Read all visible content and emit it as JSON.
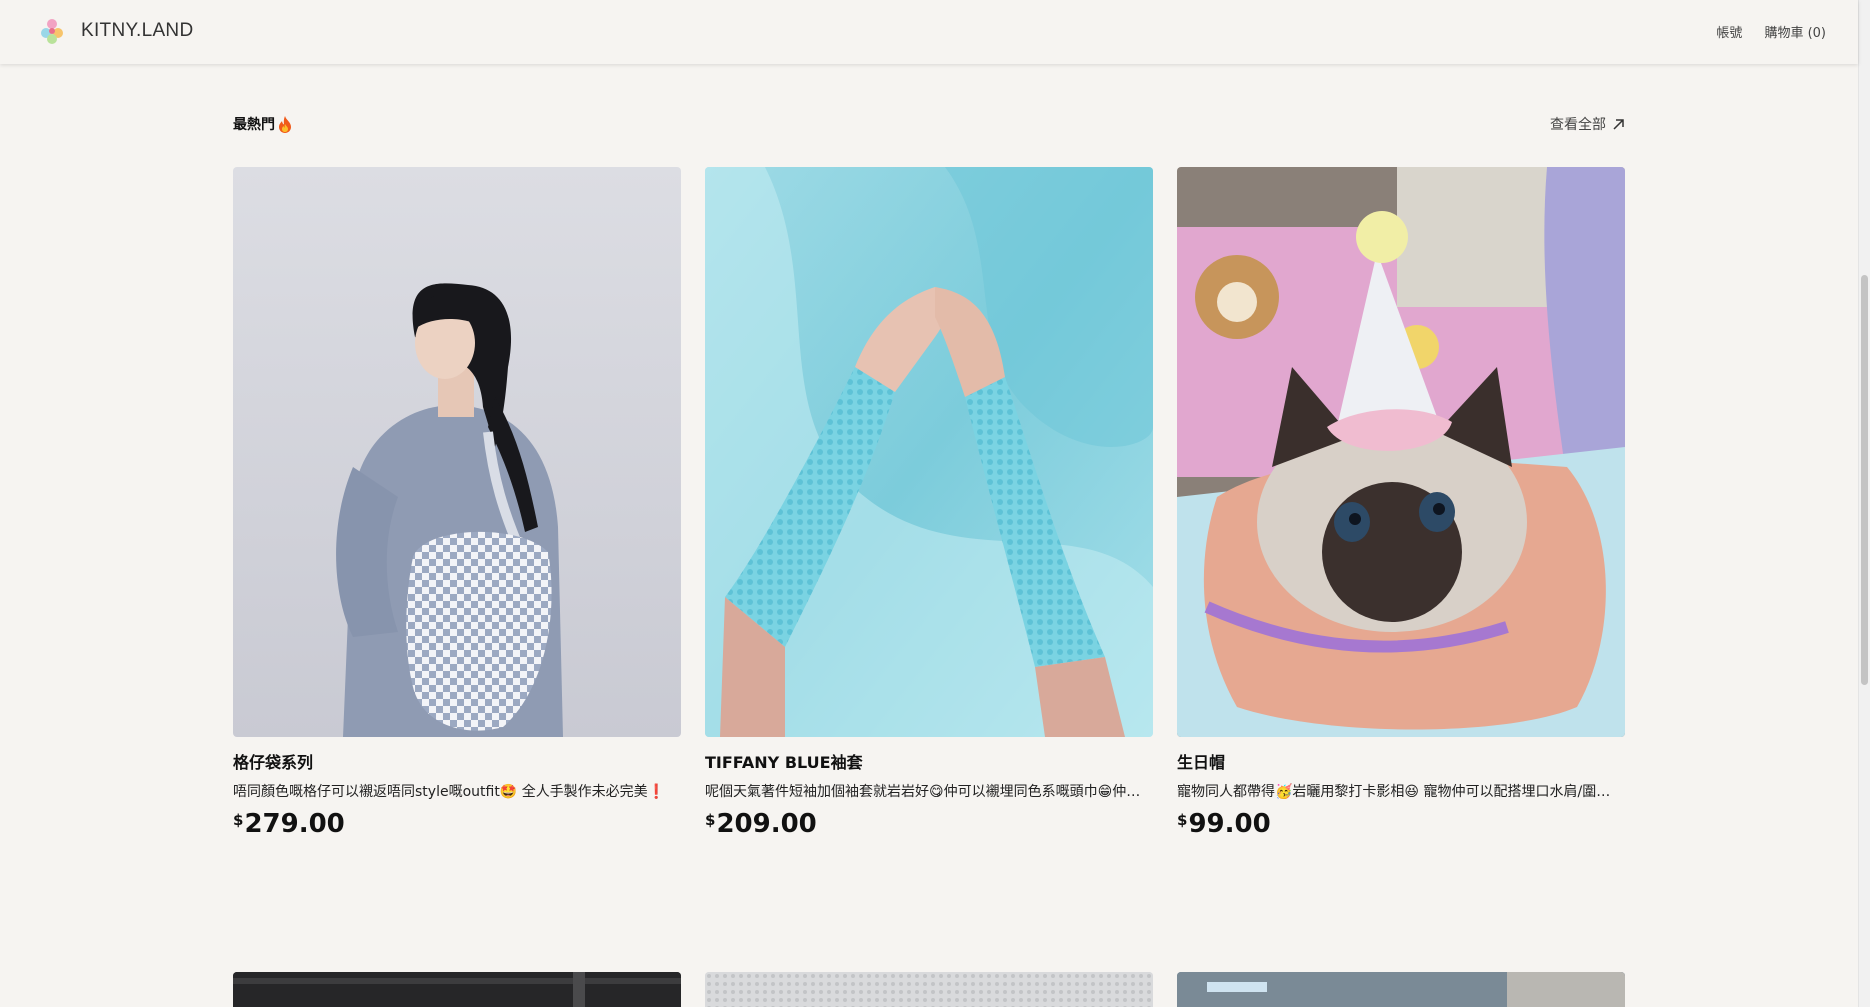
{
  "header": {
    "brand": "KITNY.LAND",
    "nav": {
      "account": "帳號",
      "cart": "購物車 (0)"
    }
  },
  "section": {
    "title": "最熱門",
    "title_icon": "fire-icon",
    "view_all": "查看全部",
    "view_all_icon": "arrow-up-right-icon"
  },
  "products": [
    {
      "name": "格仔袋系列",
      "description": "唔同顏色嘅格仔可以襯返唔同style嘅outfit🤩 全人手製作未必完美❗",
      "currency": "$",
      "price": "279.00"
    },
    {
      "name": "TIFFANY BLUE袖套",
      "description": "呢個天氣著件短袖加個袖套就岩岩好😋仲可以襯埋同色系嘅頭巾😁仲…",
      "currency": "$",
      "price": "209.00"
    },
    {
      "name": "生日帽",
      "description": "寵物同人都帶得🥳岩曬用黎打卡影相😆 寵物仲可以配搭埋口水肩/圍…",
      "currency": "$",
      "price": "99.00"
    }
  ],
  "colors": {
    "background": "#f6f4f1",
    "text": "#111111",
    "accent_blue": "#7fd3e0"
  }
}
